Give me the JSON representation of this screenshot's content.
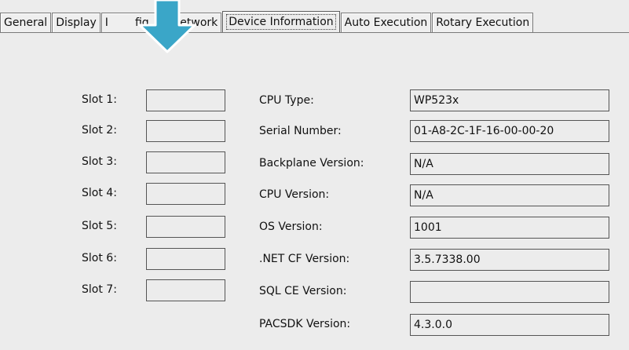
{
  "tabs": [
    {
      "label": "General"
    },
    {
      "label": "Display"
    },
    {
      "label": "IP Config"
    },
    {
      "label": "Network"
    },
    {
      "label": "Device Information",
      "active": true
    },
    {
      "label": "Auto Execution"
    },
    {
      "label": "Rotary Execution"
    }
  ],
  "tabs_visible": [
    "General",
    "Display",
    "I",
    "fig",
    "Network",
    "Device Information",
    "Auto Execution",
    "Rotary Execution"
  ],
  "slots": [
    {
      "label": "Slot 1:",
      "value": ""
    },
    {
      "label": "Slot 2:",
      "value": ""
    },
    {
      "label": "Slot 3:",
      "value": ""
    },
    {
      "label": "Slot 4:",
      "value": ""
    },
    {
      "label": "Slot 5:",
      "value": ""
    },
    {
      "label": "Slot 6:",
      "value": ""
    },
    {
      "label": "Slot 7:",
      "value": ""
    }
  ],
  "info": [
    {
      "label": "CPU  Type:",
      "value": "WP523x"
    },
    {
      "label": "Serial Number:",
      "value": "01-A8-2C-1F-16-00-00-20"
    },
    {
      "label": "Backplane Version:",
      "value": "N/A"
    },
    {
      "label": "CPU Version:",
      "value": "N/A"
    },
    {
      "label": "OS Version:",
      "value": "1001"
    },
    {
      "label": ".NET CF Version:",
      "value": "3.5.7338.00"
    },
    {
      "label": "SQL CE Version:",
      "value": ""
    },
    {
      "label": "PACSDK Version:",
      "value": "4.3.0.0"
    }
  ],
  "colors": {
    "background": "#ececec",
    "pointer": "#3aa6c8"
  },
  "icons": {
    "pointer": "pointer-arrow-icon"
  }
}
